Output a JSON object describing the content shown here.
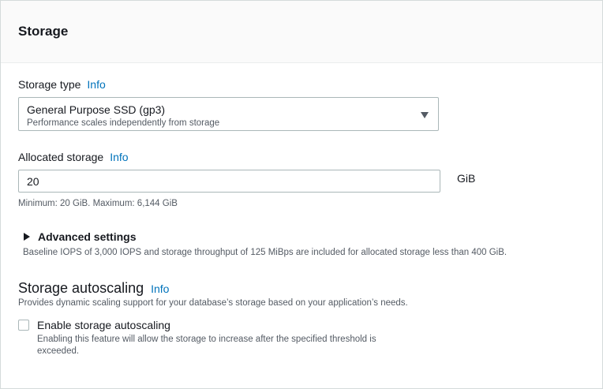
{
  "panel": {
    "title": "Storage"
  },
  "storage_type": {
    "label": "Storage type",
    "info": "Info",
    "selected_value": "General Purpose SSD (gp3)",
    "selected_description": "Performance scales independently from storage"
  },
  "allocated_storage": {
    "label": "Allocated storage",
    "info": "Info",
    "value": "20",
    "unit": "GiB",
    "constraint": "Minimum: 20 GiB. Maximum: 6,144 GiB"
  },
  "advanced_settings": {
    "label": "Advanced settings",
    "expanded": false,
    "description": "Baseline IOPS of 3,000 IOPS and storage throughput of 125 MiBps are included for allocated storage less than 400 GiB."
  },
  "autoscaling": {
    "title": "Storage autoscaling",
    "info": "Info",
    "description": "Provides dynamic scaling support for your database’s storage based on your application’s needs.",
    "checkbox_label": "Enable storage autoscaling",
    "checked": false,
    "checkbox_description_line1": "Enabling this feature will allow the storage to increase after the specified threshold is",
    "checkbox_description_line2": "exceeded."
  },
  "colors": {
    "link": "#0073bb",
    "text": "#16191f",
    "secondary_text": "#545b64",
    "border": "#aab7b8"
  }
}
